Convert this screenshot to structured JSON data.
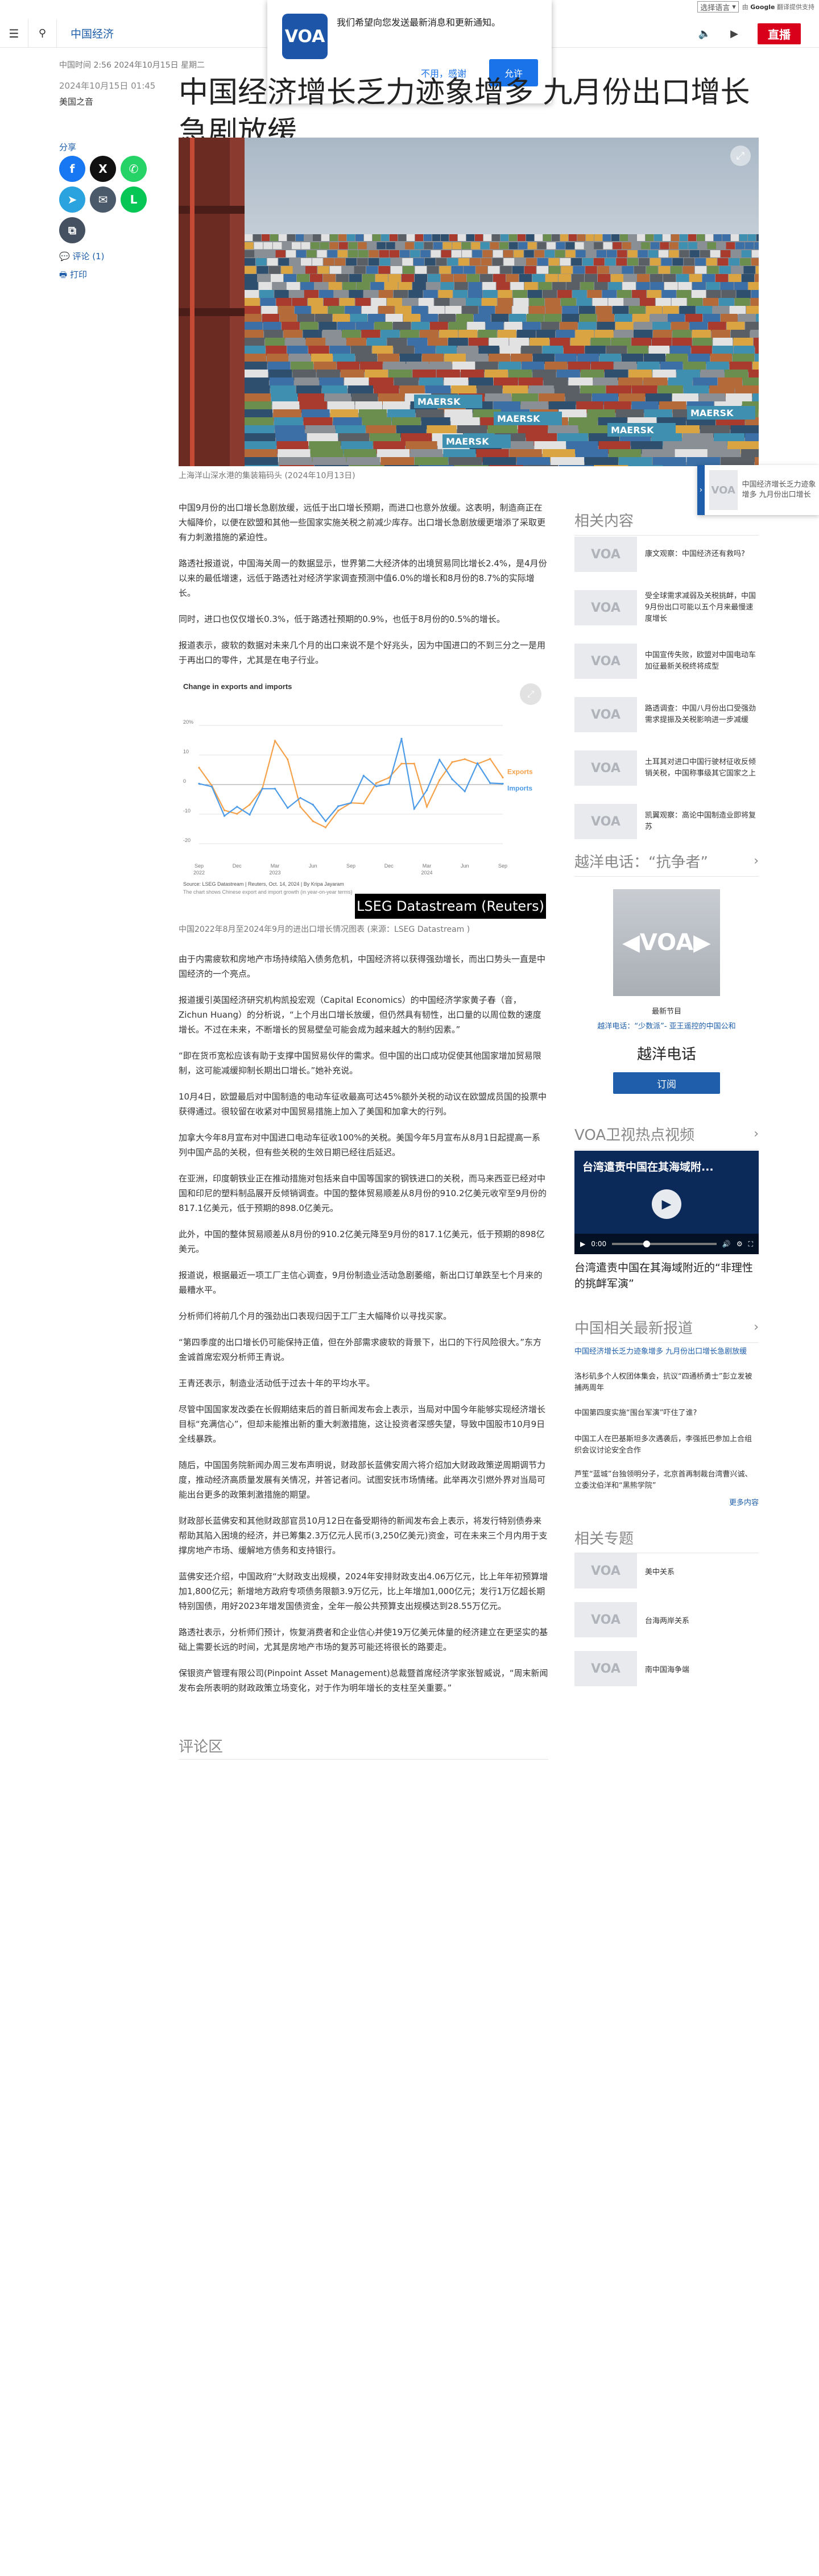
{
  "translate": {
    "select_label": "选择语言",
    "powered_prefix": "由",
    "powered_brand": "Google",
    "powered_suffix": "翻译提供支持"
  },
  "nav": {
    "section": "中国经济",
    "live_label": "直播",
    "menu_icon": "hamburger-icon",
    "search_icon": "search-icon"
  },
  "notification": {
    "logo_text": "VOA",
    "message": "我们希望向您发送最新消息和更新通知。",
    "decline_label": "不用，感谢",
    "accept_label": "允许"
  },
  "meta": {
    "updated": "中国时间 2:56 2024年10月15日 星期二",
    "date": "2024年10月15日 01:45",
    "author": "美国之音"
  },
  "headline": "中国经济增长乏力迹象增多 九月份出口增长急剧放缓",
  "share": {
    "label": "分享",
    "comments_link": "评论 (1)",
    "print_link": "打印"
  },
  "hero": {
    "caption": "上海洋山深水港的集装箱码头 (2024年10月13日)",
    "brand_text": "MAERSK"
  },
  "article": {
    "paragraphs_top": [
      "中国9月份的出口增长急剧放缓，远低于出口增长预期，而进口也意外放缓。这表明，制造商正在大幅降价，以便在欧盟和其他一些国家实施关税之前减少库存。出口增长急剧放缓更增添了采取更有力刺激措施的紧迫性。",
      "路透社报道说，中国海关周一的数据显示，世界第二大经济体的出境贸易同比增长2.4%，是4月份以来的最低增速，远低于路透社对经济学家调查预测中值6.0%的增长和8月份的8.7%的实际增长。",
      "同时，进口也仅仅增长0.3%，低于路透社预期的0.9%，也低于8月份的0.5%的增长。",
      "报道表示，疲软的数据对未来几个月的出口来说不是个好兆头，因为中国进口的不到三分之一是用于再出口的零件，尤其是在电子行业。"
    ],
    "paragraphs_bottom": [
      "由于内需疲软和房地产市场持续陷入债务危机，中国经济将以获得强劲增长，而出口势头一直是中国经济的一个亮点。",
      "报道援引英国经济研究机构凯投宏观（Capital Economics）的中国经济学家黄子春（音，Zichun Huang）的分析说，“上个月出口增长放缓，但仍然具有韧性，出口量的以周位数的速度增长。不过在未来，不断增长的贸易壁垒可能会成为越来越大的制约因素。”",
      "“即在货币宽松应该有助于支撑中国贸易伙伴的需求。但中国的出口成功促使其他国家增加贸易限制，这可能减缓抑制长期出口增长。”她补充说。",
      "10月4日，欧盟最后对中国制造的电动车征收最高可达45%额外关税的动议在欧盟成员国的投票中获得通过。很较留在收紧对中国贸易措施上加入了美国和加拿大的行列。",
      "加拿大今年8月宣布对中国进口电动车征收100%的关税。美国今年5月宣布从8月1日起提高一系列中国产品的关税，但有些关税的生效日期已经往后延迟。",
      "在亚洲，印度朝铁业正在推动措施对包括来自中国等国家的钢铁进口的关税，而马来西亚已经对中国和印尼的塑料制品展开反倾销调查。中国的整体贸易顺差从8月份的910.2亿美元收窄至9月份的817.1亿美元，低于预期的898.0亿美元。",
      "此外，中国的整体贸易顺差从8月份的910.2亿美元降至9月份的817.1亿美元，低于预期的898亿美元。",
      "报道说，根据最近一项工厂主信心调查，9月份制造业活动急剧萎缩，新出口订单跌至七个月来的最糟水平。",
      "分析师们将前几个月的强劲出口表现归因于工厂主大幅降价以寻找买家。",
      "“第四季度的出口增长仍可能保持正值，但在外部需求疲软的背景下，出口的下行风险很大。”东方金诚首席宏观分析师王青说。",
      "王青还表示，制造业活动低于过去十年的平均水平。",
      "尽管中国国家发改委在长假期结束后的首日新闻发布会上表示，当局对中国今年能够实现经济增长目标“充满信心”，但却未能推出新的重大刺激措施，这让投资者深感失望，导致中国股市10月9日全线暴跌。",
      "随后，中国国务院新闻办周三发布声明说，财政部长蓝佛安周六将介绍加大财政政策逆周期调节力度，推动经济高质量发展有关情况，并答记者问。试图安抚市场情绪。此举再次引燃外界对当局可能出台更多的政策刺激措施的期望。",
      "财政部长蓝佛安和其他财政部官员10月12日在备受期待的新闻发布会上表示，将发行特别债券来帮助其陷入困境的经济，并已筹集2.3万亿元人民币(3,250亿美元)资金，可在未来三个月内用于支撑房地产市场、缓解地方债务和支持银行。",
      "蓝佛安还介绍，中国政府“大财政支出规模，2024年安排财政支出4.06万亿元，比上年年初预算增加1,800亿元；新增地方政府专项债务限额3.9万亿元，比上年增加1,000亿元；发行1万亿超长期特别国债，用好2023年增发国债资金，全年一般公共预算支出规模达到28.55万亿元。",
      "路透社表示，分析师们预计，恢复消费者和企业信心并使19万亿美元体量的经济建立在更坚实的基础上需要长远的时间，尤其是房地产市场的复苏可能还将很长的路要走。",
      "保银资产管理有限公司(Pinpoint Asset Management)总裁暨首席经济学家张智威说，“周末新闻发布会所表明的财政政策立场变化，对于作为明年增长的支柱至关重要。”"
    ]
  },
  "figure": {
    "expand_icon": "expand-icon",
    "lseg_tag": "LSEG Datastream (Reuters)",
    "caption": "中国2022年8月至2024年9月的进出口增长情况图表 (来源：LSEG Datastream )"
  },
  "chart_data": {
    "type": "line",
    "title": "Change in exports and imports",
    "source": "Source: LSEG Datastream | Reuters, Oct. 14, 2024 | By Kripa Jayaram",
    "note": "The chart shows Chinese export and import growth (in year-on-year terms)",
    "ylabel": "",
    "y_tick_labels": [
      "20%",
      "10",
      "0",
      "-10",
      "-20"
    ],
    "ylim": [
      -25,
      25
    ],
    "x": [
      "2022-09",
      "2022-10",
      "2022-11",
      "2022-12",
      "2023-01",
      "2023-02",
      "2023-03",
      "2023-04",
      "2023-05",
      "2023-06",
      "2023-07",
      "2023-08",
      "2023-09",
      "2023-10",
      "2023-11",
      "2023-12",
      "2024-01",
      "2024-02",
      "2024-03",
      "2024-04",
      "2024-05",
      "2024-06",
      "2024-07",
      "2024-08",
      "2024-09"
    ],
    "x_tick_labels": [
      {
        "at": "2022-09",
        "label": "Sep"
      },
      {
        "at": "2022-12",
        "label": "Dec"
      },
      {
        "at": "2023-03",
        "label": "Mar"
      },
      {
        "at": "2023-06",
        "label": "Jun"
      },
      {
        "at": "2023-09",
        "label": "Sep"
      },
      {
        "at": "2023-12",
        "label": "Dec"
      },
      {
        "at": "2024-03",
        "label": "Mar"
      },
      {
        "at": "2024-06",
        "label": "Jun"
      },
      {
        "at": "2024-09",
        "label": "Sep"
      }
    ],
    "x_year_labels": [
      {
        "at": "2022-09",
        "label": "2022"
      },
      {
        "at": "2023-03",
        "label": "2023"
      },
      {
        "at": "2024-03",
        "label": "2024"
      }
    ],
    "series": [
      {
        "name": "Exports",
        "color": "#f5a14a",
        "values": [
          5.7,
          -0.3,
          -8.7,
          -9.9,
          -6.8,
          -1.3,
          14.8,
          8.5,
          -7.5,
          -12.4,
          -14.5,
          -8.8,
          -6.2,
          -6.4,
          0.5,
          2.3,
          7.1,
          7.1,
          -7.5,
          1.5,
          7.6,
          8.6,
          7.0,
          8.7,
          2.4
        ]
      },
      {
        "name": "Imports",
        "color": "#4c9be8",
        "values": [
          0.3,
          -0.7,
          -10.6,
          -7.5,
          -10.2,
          -1.4,
          -1.4,
          -7.9,
          -4.5,
          -6.8,
          -12.4,
          -7.3,
          -6.2,
          3.0,
          -0.6,
          0.2,
          15.5,
          -8.2,
          -1.9,
          8.4,
          1.8,
          -2.3,
          7.2,
          0.5,
          0.3
        ]
      }
    ],
    "grid": true
  },
  "sidebar": {
    "related_heading": "相关内容",
    "related_items": [
      "康文观察：中国经济还有救吗?",
      "受全球需求减弱及关税挑衅，中国9月份出口可能以五个月来最慢速度增长",
      "中国宣传失败，欧盟对中国电动车加征最新关税终将成型",
      "路透调查：中国八月份出口受强劲需求提振及关税影响进一步减缓",
      "土耳其对进口中国行驶材征收反倾销关税，中国称事级其它国家之上",
      "凯翼观察：高论中国制造业即将复苏"
    ],
    "radio_heading": "越洋电话：“抗争者”",
    "radio_label": "最新节目",
    "radio_sub": "越洋电话：“少数派”- 亚王遥控的中国公和",
    "radio_phone": "越洋电话",
    "radio_subscribe": "订阅",
    "video_heading": "VOA卫视热点视频",
    "video_overlay": "台湾遣责中国在其海域附...",
    "video_time": "0:00",
    "video_caption": "台湾遣责中国在其海域附近的“非理性的挑衅军演”",
    "news_heading": "中国相关最新报道",
    "news_items": [
      {
        "text": "中国经济增长乏力迹象增多 九月份出口增长急剧放缓",
        "blue": true
      },
      {
        "text": "洛杉矶多个人权团体集会，抗议“四通桥勇士”彭立发被捕两周年",
        "blue": false
      },
      {
        "text": "中国第四度实施“围台军演”吓住了谁?",
        "blue": false
      },
      {
        "text": "中国工人在巴基斯坦多次遇袭后，李强抵巴参加上合组织会议讨论安全合作",
        "blue": false
      },
      {
        "text": "芦笙“蓝城”台独领明分子，北京首再制裁台湾曹兴诚、立委沈伯洋和“黑熊学院”",
        "blue": false
      }
    ],
    "more_label": "更多内容",
    "topics_heading": "相关专题",
    "topics": [
      "美中关系",
      "台海两岸关系",
      "南中国海争端"
    ],
    "float_text": "中国经济增长乏力迹象增多 九月份出口增长"
  },
  "comments": {
    "heading": "评论区"
  }
}
